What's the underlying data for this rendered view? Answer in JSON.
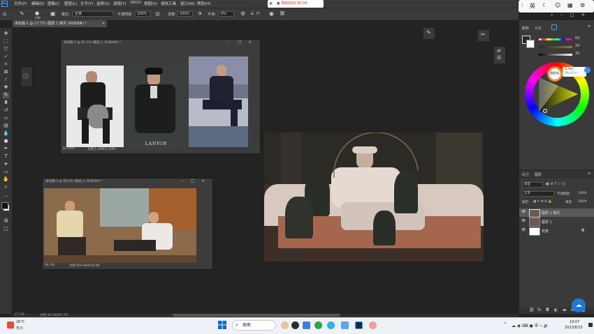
{
  "menubar": {
    "items": [
      "文件(F)",
      "编辑(E)",
      "图像(I)",
      "图层(L)",
      "文字(Y)",
      "选择(S)",
      "滤镜(T)",
      "3D(D)",
      "视图(V)",
      "增效工具",
      "窗口(W)",
      "帮助(H)"
    ]
  },
  "recording": {
    "text": "● 录制中00:06:39"
  },
  "ime": {
    "mode": "英",
    "icons": [
      "moon-icon",
      "emoji-icon",
      "settings-icon"
    ]
  },
  "options": {
    "brush_size": "208",
    "mode_label": "模式：",
    "mode_value": "正常",
    "opacity_label": "不透明度：",
    "opacity_value": "100%",
    "flow_label": "流量：",
    "flow_value": "100%",
    "smooth_label": "平滑：",
    "smooth_value": "0%",
    "angle_value": "0°"
  },
  "doc_tab": {
    "title": "未标题-1 @ 17.7% (图层 1 拷贝, RGB/8#) *"
  },
  "ref_window_1": {
    "title": "未标题-2 @ 62.1% (图层 1, RGB/8#) *",
    "zoom": "62.09%",
    "doc_info": "文档:1.49M/1.49M",
    "image3_caption": "LANVIN"
  },
  "ref_window_2": {
    "title": "未标题-3 @ 68.3% (图层 1, RGB/8#) *",
    "zoom": "68.3%",
    "doc_info": "文档:919.9K/919.9K"
  },
  "statusbar": {
    "zoom": "17.7%",
    "doc_info": "文档:39.3M/69.7M"
  },
  "color_panel": {
    "tabs": [
      "颜色",
      "色板"
    ],
    "values": [
      "69",
      "26",
      "20"
    ],
    "monitor_percent": "89%",
    "net_speed": "112K/s",
    "cpu": "CPU 47℃",
    "colors": {
      "foreground": "#2b2a24",
      "background": "#ffffff"
    }
  },
  "layers_panel": {
    "tabs": [
      "路径",
      "图层"
    ],
    "filter_label": "类型",
    "blend_mode": "正常",
    "opacity_label": "不透明度:",
    "opacity_value": "100%",
    "lock_label": "锁定:",
    "fill_label": "填充:",
    "fill_value": "100%",
    "layers": [
      {
        "name": "图层 1 拷贝",
        "selected": true
      },
      {
        "name": "图层 1",
        "selected": false
      },
      {
        "name": "背景",
        "selected": false
      }
    ]
  },
  "taskbar": {
    "weather_temp": "26°C",
    "weather_desc": "热点",
    "search_placeholder": "搜索",
    "time": "19:07",
    "date": "2023/8/15"
  }
}
